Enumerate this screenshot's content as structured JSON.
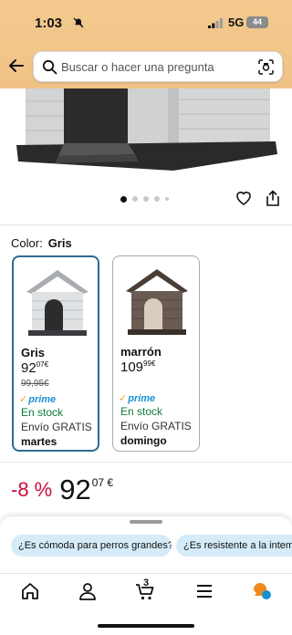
{
  "status_bar": {
    "time": "1:03",
    "network": "5G",
    "battery": "44"
  },
  "search": {
    "placeholder": "Buscar o hacer una pregunta"
  },
  "carousel": {
    "dot_count": 5,
    "active_index": 0
  },
  "color": {
    "label": "Color:",
    "selected": "Gris"
  },
  "variants": [
    {
      "name": "Gris",
      "price_whole": "92",
      "price_cents": "07",
      "currency": "€",
      "old_price": "99,95€",
      "prime": "prime",
      "stock": "En stock",
      "shipping": "Envío GRATIS",
      "delivery": "martes",
      "selected": true
    },
    {
      "name": "marrón",
      "price_whole": "109",
      "price_cents": "99",
      "currency": "€",
      "prime": "prime",
      "stock": "En stock",
      "shipping": "Envío GRATIS",
      "delivery": "domingo",
      "selected": false
    }
  ],
  "deal": {
    "discount": "-8 %",
    "price_whole": "92",
    "price_cents": "07 €"
  },
  "questions": [
    "¿Es cómoda para perros grandes?",
    "¿Es resistente a la intemp"
  ],
  "nav": {
    "cart_count": "3"
  },
  "colors": {
    "header": "#f3c98e",
    "accent_blue": "#2e6b8f",
    "deal_red": "#cc0c39",
    "stock_green": "#0d7a3a",
    "chip_bg": "#d5ecf8"
  }
}
